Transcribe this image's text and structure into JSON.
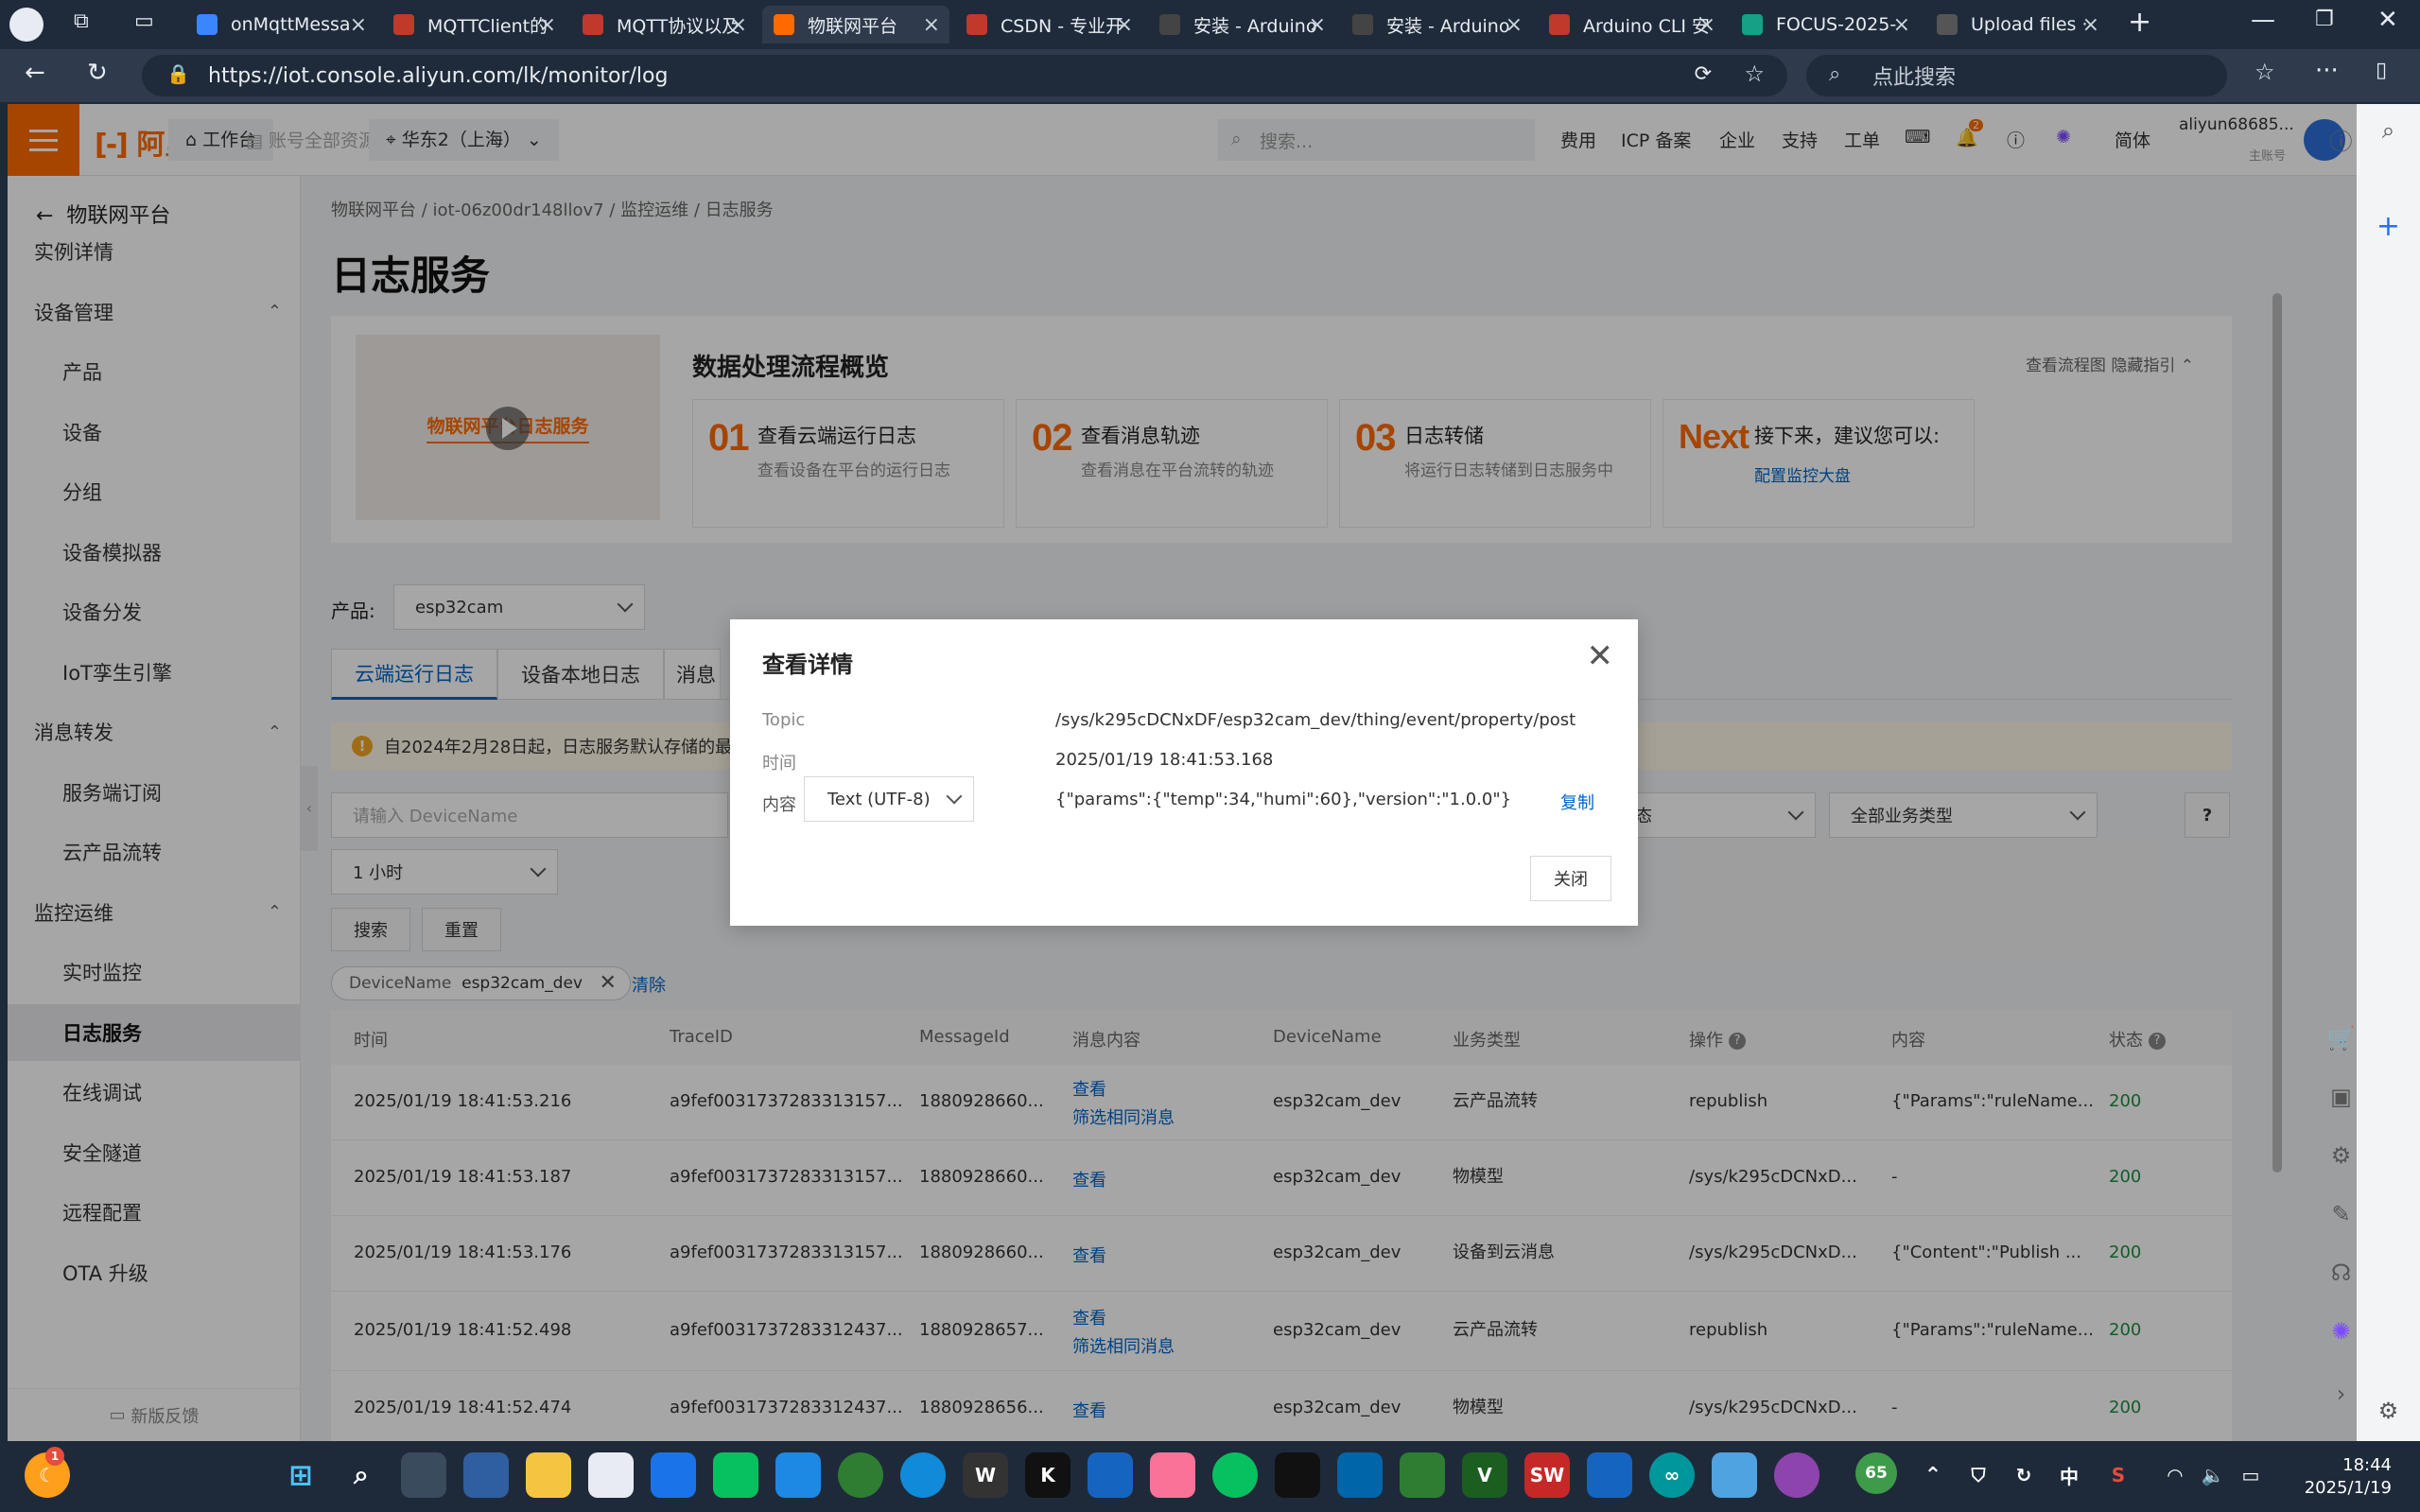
{
  "browser": {
    "tabs": [
      {
        "title": "onMqttMessa",
        "color": "#3a86ff",
        "active": false
      },
      {
        "title": "MQTTClient的",
        "color": "#c0392b",
        "active": false
      },
      {
        "title": "MQTT协议以及",
        "color": "#c0392b",
        "active": false
      },
      {
        "title": "物联网平台",
        "color": "#ff6a00",
        "active": true
      },
      {
        "title": "CSDN - 专业开",
        "color": "#c0392b",
        "active": false
      },
      {
        "title": "安装 - Arduino",
        "color": "#444",
        "active": false
      },
      {
        "title": "安装 - Arduino",
        "color": "#444",
        "active": false
      },
      {
        "title": "Arduino CLI 安",
        "color": "#c0392b",
        "active": false
      },
      {
        "title": "FOCUS-2025-",
        "color": "#16a085",
        "active": false
      },
      {
        "title": "Upload files ·",
        "color": "#555",
        "active": false
      }
    ],
    "url": "https://iot.console.aliyun.com/lk/monitor/log",
    "search_placeholder": "点此搜索"
  },
  "topnav": {
    "logo": "阿里云",
    "workbench": "工作台",
    "account_scope": "账号全部资源",
    "region": "华东2（上海）",
    "search_placeholder": "搜索...",
    "links": [
      "费用",
      "ICP 备案",
      "企业",
      "支持",
      "工单"
    ],
    "notification_count": "2",
    "language": "简体",
    "user_name": "aliyun68685...",
    "user_role": "主账号"
  },
  "sidebar": {
    "back_label": "物联网平台",
    "items": [
      {
        "label": "实例详情",
        "level": 1
      },
      {
        "label": "设备管理",
        "level": 1,
        "group": true
      },
      {
        "label": "产品",
        "level": 2
      },
      {
        "label": "设备",
        "level": 2
      },
      {
        "label": "分组",
        "level": 2
      },
      {
        "label": "设备模拟器",
        "level": 2
      },
      {
        "label": "设备分发",
        "level": 2
      },
      {
        "label": "IoT孪生引擎",
        "level": 2
      },
      {
        "label": "消息转发",
        "level": 1,
        "group": true
      },
      {
        "label": "服务端订阅",
        "level": 2
      },
      {
        "label": "云产品流转",
        "level": 2
      },
      {
        "label": "监控运维",
        "level": 1,
        "group": true
      },
      {
        "label": "实时监控",
        "level": 2
      },
      {
        "label": "日志服务",
        "level": 2,
        "active": true
      },
      {
        "label": "在线调试",
        "level": 2
      },
      {
        "label": "安全隧道",
        "level": 2
      },
      {
        "label": "远程配置",
        "level": 2
      },
      {
        "label": "OTA 升级",
        "level": 2
      }
    ],
    "feedback": "新版反馈"
  },
  "main": {
    "breadcrumb": "物联网平台  /  iot-06z00dr148llov7  /  监控运维  /  日志服务",
    "title": "日志服务",
    "guide": {
      "video_text": "物联网平台日志服务",
      "title": "数据处理流程概览",
      "links": "查看流程图    隐藏指引 ⌃",
      "steps": [
        {
          "num": "01",
          "title": "查看云端运行日志",
          "desc": "查看设备在平台的运行日志"
        },
        {
          "num": "02",
          "title": "查看消息轨迹",
          "desc": "查看消息在平台流转的轨迹"
        },
        {
          "num": "03",
          "title": "日志转储",
          "desc": "将运行日志转储到日志服务中"
        },
        {
          "num": "Next",
          "title": "接下来，建议您可以:",
          "link": "配置监控大盘"
        }
      ]
    },
    "product_label": "产品:",
    "product_value": "esp32cam",
    "tabs": [
      "云端运行日志",
      "设备本地日志",
      "消息"
    ],
    "notice": "自2024年2月28日起，日志服务默认存储的最",
    "filter": {
      "device_placeholder": "请输入 DeviceName",
      "status_value": "状态",
      "biz_type_value": "全部业务类型",
      "time_value": "1 小时",
      "search_btn": "搜索",
      "reset_btn": "重置",
      "tag_key": "DeviceName",
      "tag_value": "esp32cam_dev",
      "clear": "清除"
    },
    "table": {
      "headers": [
        "时间",
        "TraceID",
        "MessageId",
        "消息内容",
        "DeviceName",
        "业务类型",
        "操作",
        "内容",
        "状态"
      ],
      "rows": [
        {
          "time": "2025/01/19 18:41:53.216",
          "trace": "a9fef0031737283313157...",
          "msgid": "1880928660...",
          "view": "查看",
          "filter": "筛选相同消息",
          "device": "esp32cam_dev",
          "biz": "云产品流转",
          "op": "republish",
          "content": "{\"Params\":\"ruleName...",
          "status": "200"
        },
        {
          "time": "2025/01/19 18:41:53.187",
          "trace": "a9fef0031737283313157...",
          "msgid": "1880928660...",
          "view": "查看",
          "filter": "",
          "device": "esp32cam_dev",
          "biz": "物模型",
          "op": "/sys/k295cDCNxD...",
          "content": "-",
          "status": "200"
        },
        {
          "time": "2025/01/19 18:41:53.176",
          "trace": "a9fef0031737283313157...",
          "msgid": "1880928660...",
          "view": "查看",
          "filter": "",
          "device": "esp32cam_dev",
          "biz": "设备到云消息",
          "op": "/sys/k295cDCNxD...",
          "content": "{\"Content\":\"Publish ...",
          "status": "200"
        },
        {
          "time": "2025/01/19 18:41:52.498",
          "trace": "a9fef0031737283312437...",
          "msgid": "1880928657...",
          "view": "查看",
          "filter": "筛选相同消息",
          "device": "esp32cam_dev",
          "biz": "云产品流转",
          "op": "republish",
          "content": "{\"Params\":\"ruleName...",
          "status": "200"
        },
        {
          "time": "2025/01/19 18:41:52.474",
          "trace": "a9fef0031737283312437...",
          "msgid": "1880928656...",
          "view": "查看",
          "filter": "",
          "device": "esp32cam_dev",
          "biz": "物模型",
          "op": "/sys/k295cDCNxD...",
          "content": "-",
          "status": "200"
        }
      ]
    }
  },
  "modal": {
    "title": "查看详情",
    "topic_label": "Topic",
    "topic_value": "/sys/k295cDCNxDF/esp32cam_dev/thing/event/property/post",
    "time_label": "时间",
    "time_value": "2025/01/19 18:41:53.168",
    "content_label": "内容",
    "encoding": "Text (UTF-8)",
    "content_value": "{\"params\":{\"temp\":34,\"humi\":60},\"version\":\"1.0.0\"}",
    "copy": "复制",
    "close_btn": "关闭"
  },
  "taskbar": {
    "time": "18:44",
    "date": "2025/1/19",
    "ime": "中",
    "badge": "65",
    "widget_badge": "1"
  }
}
